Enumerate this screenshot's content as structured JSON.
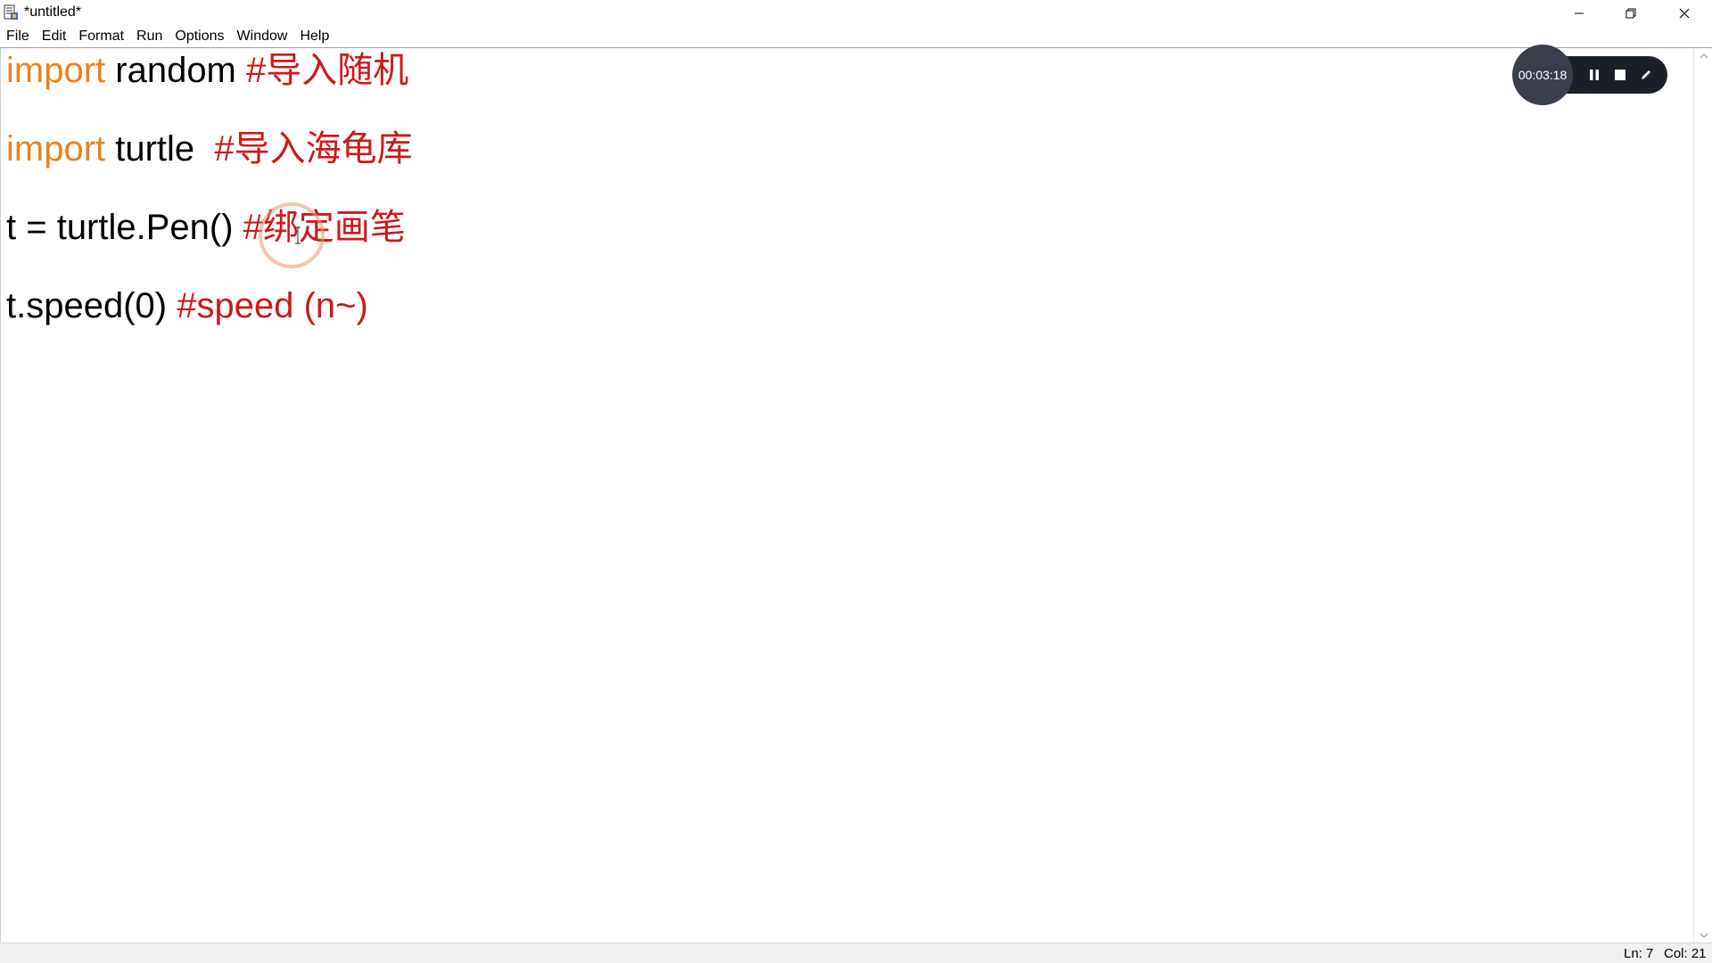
{
  "window": {
    "title": "*untitled*"
  },
  "menu": {
    "items": [
      "File",
      "Edit",
      "Format",
      "Run",
      "Options",
      "Window",
      "Help"
    ]
  },
  "editor": {
    "lines": [
      {
        "keyword": "import",
        "plain": " random ",
        "comment": "#导入随机"
      },
      {
        "keyword": "import",
        "plain": " turtle  ",
        "comment": "#导入海龟库"
      },
      {
        "keyword": "",
        "plain": "t = turtle.Pen() ",
        "comment": "#绑定画笔"
      },
      {
        "keyword": "",
        "plain": "t.speed(0) ",
        "comment": "#speed (n~)"
      }
    ]
  },
  "colors": {
    "keyword": "#e8821f",
    "comment": "#cc1a1a",
    "plain": "#000000",
    "recorder_bg": "#1b1f27"
  },
  "recorder": {
    "elapsed": "00:03:18",
    "icons": [
      "pause-icon",
      "stop-icon",
      "pen-icon"
    ]
  },
  "status": {
    "line": "Ln: 7",
    "col": "Col: 21"
  }
}
